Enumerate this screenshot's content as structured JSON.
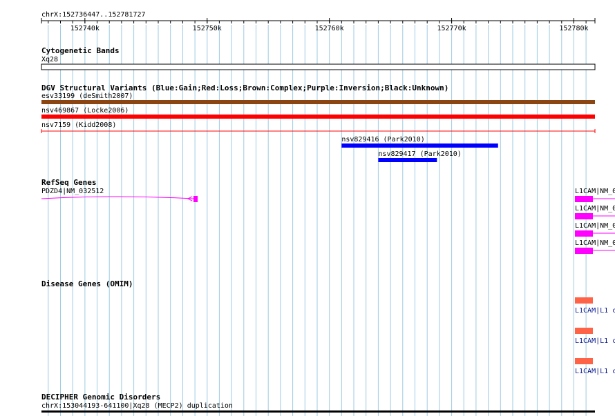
{
  "position": "chrX:152736447..152781727",
  "ruler": {
    "start": 152736447,
    "end": 152781727,
    "major_ticks": [
      {
        "pos": 152740000,
        "label": "152740k"
      },
      {
        "pos": 152750000,
        "label": "152750k"
      },
      {
        "pos": 152760000,
        "label": "152760k"
      },
      {
        "pos": 152770000,
        "label": "152770k"
      },
      {
        "pos": 152780000,
        "label": "152780k"
      }
    ]
  },
  "colors": {
    "grid": "#9ecae1",
    "gain": "#0000ff",
    "loss": "#ff0000",
    "complex": "#8b4513",
    "refseq": "#ff00ff",
    "omim": "#ff6347",
    "link": "#0a1a8c"
  },
  "tracks": {
    "cytoband": {
      "title": "Cytogenetic Bands",
      "band": "Xq28"
    },
    "dgv": {
      "title": "DGV Structural Variants (Blue:Gain;Red:Loss;Brown:Complex;Purple:Inversion;Black:Unknown)",
      "features": [
        {
          "label": "esv33199 (deSmith2007)",
          "color": "complex",
          "style": "bar",
          "start": 152736447,
          "end": 152781727
        },
        {
          "label": "nsv469867 (Locke2006)",
          "color": "loss",
          "style": "bar",
          "start": 152736447,
          "end": 152781727
        },
        {
          "label": "nsv7159 (Kidd2008)",
          "color": "loss",
          "style": "line",
          "start": 152736447,
          "end": 152781727
        },
        {
          "label": "nsv829416 (Park2010)",
          "color": "gain",
          "style": "bar",
          "start": 152761000,
          "end": 152773800
        },
        {
          "label": "nsv829417 (Park2010)",
          "color": "gain",
          "style": "bar",
          "start": 152764000,
          "end": 152768800
        }
      ]
    },
    "refseq": {
      "title": "RefSeq Genes",
      "pdzd4_label": "PDZD4|NM_032512",
      "l1cam_labels": [
        "L1CAM|NM_0",
        "L1CAM|NM_0",
        "L1CAM|NM_0",
        "L1CAM|NM_0"
      ]
    },
    "omim": {
      "title": "Disease Genes (OMIM)",
      "labels": [
        "L1CAM|L1 c",
        "L1CAM|L1 c",
        "L1CAM|L1 c"
      ]
    },
    "decipher": {
      "title": "DECIPHER Genomic Disorders",
      "label": "chrX:153044193-641100|Xq28 (MECP2) duplication"
    }
  }
}
